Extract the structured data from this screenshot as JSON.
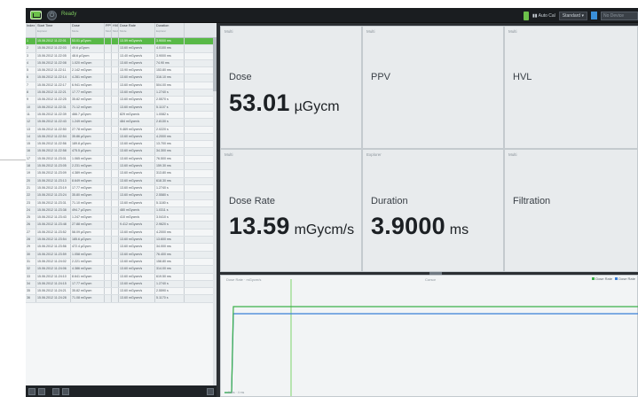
{
  "topbar": {
    "status": "Ready",
    "auto_cal_label": "Auto Cal",
    "preset": "Standard",
    "device_placeholder": "No Device"
  },
  "table": {
    "columns": [
      {
        "label": "Index",
        "sub": ""
      },
      {
        "label": "Start Time",
        "sub": "Explorer"
      },
      {
        "label": "Dose",
        "sub": "Mode"
      },
      {
        "label": "PPV",
        "sub": "Mode"
      },
      {
        "label": "HVL",
        "sub": "Mode"
      },
      {
        "label": "Dose Rate",
        "sub": "Mode"
      },
      {
        "label": "Duration",
        "sub": "Explorer"
      }
    ],
    "rows": [
      [
        "1",
        "15.06.2012 11:22:01",
        "53.01 µGycm",
        "",
        "",
        "13.59 mGycm/s",
        "3.9000 ms"
      ],
      [
        "2",
        "15.06.2012 11:22:03",
        "49.6 µGycm",
        "",
        "",
        "13.60 mGycm/s",
        "4.0100 ms"
      ],
      [
        "3",
        "15.06.2012 11:22:05",
        "48.6 µGycm",
        "",
        "",
        "13.40 mGycm/s",
        "3.9000 ms"
      ],
      [
        "4",
        "15.06.2012 11:22:08",
        "1.020 mGycm",
        "",
        "",
        "13.60 mGycm/s",
        "74.90 ms"
      ],
      [
        "5",
        "15.06.2012 11:22:11",
        "2.142 mGycm",
        "",
        "",
        "13.90 mGycm/s",
        "153.80 ms"
      ],
      [
        "6",
        "15.06.2012 11:22:14",
        "4.281 mGycm",
        "",
        "",
        "13.60 mGycm/s",
        "316.10 ms"
      ],
      [
        "7",
        "15.06.2012 11:22:17",
        "6.941 mGycm",
        "",
        "",
        "13.60 mGycm/s",
        "504.00 ms"
      ],
      [
        "8",
        "15.06.2012 11:22:21",
        "17.77 mGycm",
        "",
        "",
        "13.60 mGycm/s",
        "1.2740 s"
      ],
      [
        "9",
        "15.06.2012 11:22:25",
        "35.82 mGycm",
        "",
        "",
        "13.60 mGycm/s",
        "2.5570 s"
      ],
      [
        "10",
        "15.06.2012 11:22:31",
        "71.12 mGycm",
        "",
        "",
        "13.60 mGycm/s",
        "5.1107 s"
      ],
      [
        "11",
        "15.06.2012 11:22:39",
        "466.7 µGycm",
        "",
        "",
        "829 mGycm/s",
        "1.0082 s"
      ],
      [
        "12",
        "15.06.2012 11:22:43",
        "1.249 mGycm",
        "",
        "",
        "484 mGycm/s",
        "2.8130 s"
      ],
      [
        "13",
        "15.06.2012 11:22:50",
        "27.78 mGycm",
        "",
        "",
        "9.469 mGycm/s",
        "2.0220 s"
      ],
      [
        "14",
        "15.06.2012 11:22:54",
        "35.86 µGycm",
        "",
        "",
        "13.60 mGycm/s",
        "4.2000 ms"
      ],
      [
        "15",
        "15.06.2012 11:22:56",
        "189.8 µGycm",
        "",
        "",
        "13.60 mGycm/s",
        "13.700 ms"
      ],
      [
        "16",
        "15.06.2012 11:22:58",
        "475.5 µGycm",
        "",
        "",
        "13.60 mGycm/s",
        "34.300 ms"
      ],
      [
        "17",
        "15.06.2012 11:23:01",
        "1.065 mGycm",
        "",
        "",
        "13.60 mGycm/s",
        "76.500 ms"
      ],
      [
        "18",
        "15.06.2012 11:23:05",
        "2.231 mGycm",
        "",
        "",
        "13.60 mGycm/s",
        "159.30 ms"
      ],
      [
        "19",
        "15.06.2012 11:23:09",
        "4.389 mGycm",
        "",
        "",
        "13.60 mGycm/s",
        "313.80 ms"
      ],
      [
        "20",
        "15.06.2012 11:23:13",
        "8.649 mGycm",
        "",
        "",
        "13.60 mGycm/s",
        "618.30 ms"
      ],
      [
        "21",
        "15.06.2012 11:23:19",
        "17.77 mGycm",
        "",
        "",
        "13.60 mGycm/s",
        "1.2740 s"
      ],
      [
        "22",
        "15.06.2012 11:23:24",
        "35.80 mGycm",
        "",
        "",
        "13.60 mGycm/s",
        "2.5580 s"
      ],
      [
        "23",
        "15.06.2012 11:23:31",
        "71.10 mGycm",
        "",
        "",
        "13.60 mGycm/s",
        "5.1180 s"
      ],
      [
        "24",
        "15.06.2012 11:23:38",
        "494.7 µGycm",
        "",
        "",
        "480 mGycm/s",
        "1.0311 s"
      ],
      [
        "25",
        "15.06.2012 11:23:43",
        "1.247 mGycm",
        "",
        "",
        "410 mGycm/s",
        "3.0410 s"
      ],
      [
        "26",
        "15.06.2012 11:23:48",
        "27.88 mGycm",
        "",
        "",
        "9.412 mGycm/s",
        "2.9620 s"
      ],
      [
        "27",
        "15.06.2012 11:23:52",
        "58.09 µGycm",
        "",
        "",
        "13.60 mGycm/s",
        "4.2000 ms"
      ],
      [
        "28",
        "15.06.2012 11:23:54",
        "185.6 µGycm",
        "",
        "",
        "13.60 mGycm/s",
        "13.600 ms"
      ],
      [
        "29",
        "15.06.2012 11:23:56",
        "472.4 µGycm",
        "",
        "",
        "13.60 mGycm/s",
        "34.000 ms"
      ],
      [
        "30",
        "15.06.2012 11:23:59",
        "1.058 mGycm",
        "",
        "",
        "13.60 mGycm/s",
        "76.400 ms"
      ],
      [
        "31",
        "15.06.2012 11:24:02",
        "2.221 mGycm",
        "",
        "",
        "13.60 mGycm/s",
        "158.80 ms"
      ],
      [
        "32",
        "15.06.2012 11:24:06",
        "4.386 mGycm",
        "",
        "",
        "13.60 mGycm/s",
        "314.00 ms"
      ],
      [
        "33",
        "15.06.2012 11:24:10",
        "8.641 mGycm",
        "",
        "",
        "13.60 mGycm/s",
        "619.50 ms"
      ],
      [
        "34",
        "15.06.2012 11:24:15",
        "17.77 mGycm",
        "",
        "",
        "13.60 mGycm/s",
        "1.2740 s"
      ],
      [
        "35",
        "15.06.2012 11:24:21",
        "35.82 mGycm",
        "",
        "",
        "13.60 mGycm/s",
        "2.5590 s"
      ],
      [
        "36",
        "15.06.2012 11:24:28",
        "71.08 mGycm",
        "",
        "",
        "13.60 mGycm/s",
        "5.1170 s"
      ]
    ]
  },
  "tiles": [
    {
      "mode": "Multi",
      "name": "Dose",
      "value": "53.01",
      "unit": "µGycm"
    },
    {
      "mode": "Multi",
      "name": "PPV",
      "value": "",
      "unit": ""
    },
    {
      "mode": "Multi",
      "name": "HVL",
      "value": "",
      "unit": ""
    },
    {
      "mode": "Multi",
      "name": "Dose Rate",
      "value": "13.59",
      "unit": "mGycm/s"
    },
    {
      "mode": "Explorer",
      "name": "Duration",
      "value": "3.9000",
      "unit": "ms"
    },
    {
      "mode": "Multi",
      "name": "Filtration",
      "value": "",
      "unit": ""
    }
  ],
  "waveform": {
    "left_label": "Dose Rate · mGycm/s",
    "cursor_label": "Cursor",
    "legend": [
      {
        "name": "Dose Rate",
        "color": "#3cb04a"
      },
      {
        "name": "Dose Rate",
        "color": "#3a7fd8"
      }
    ],
    "x_label": "0 ms · 4 ms",
    "colors": {
      "blue": "#3a7fd8",
      "green": "#3cb04a",
      "cursor": "#7fd46b"
    }
  }
}
